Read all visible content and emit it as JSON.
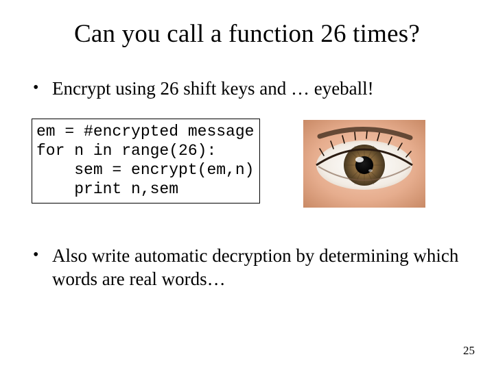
{
  "title": "Can you call a function 26 times?",
  "bullet1": "Encrypt using 26 shift keys and … eyeball!",
  "code": "em = #encrypted message\nfor n in range(26):\n    sem = encrypt(em,n)\n    print n,sem",
  "bullet2": "Also write automatic decryption by determining which words are real words…",
  "pageNumber": "25",
  "eyeAlt": "photo of a human eye"
}
